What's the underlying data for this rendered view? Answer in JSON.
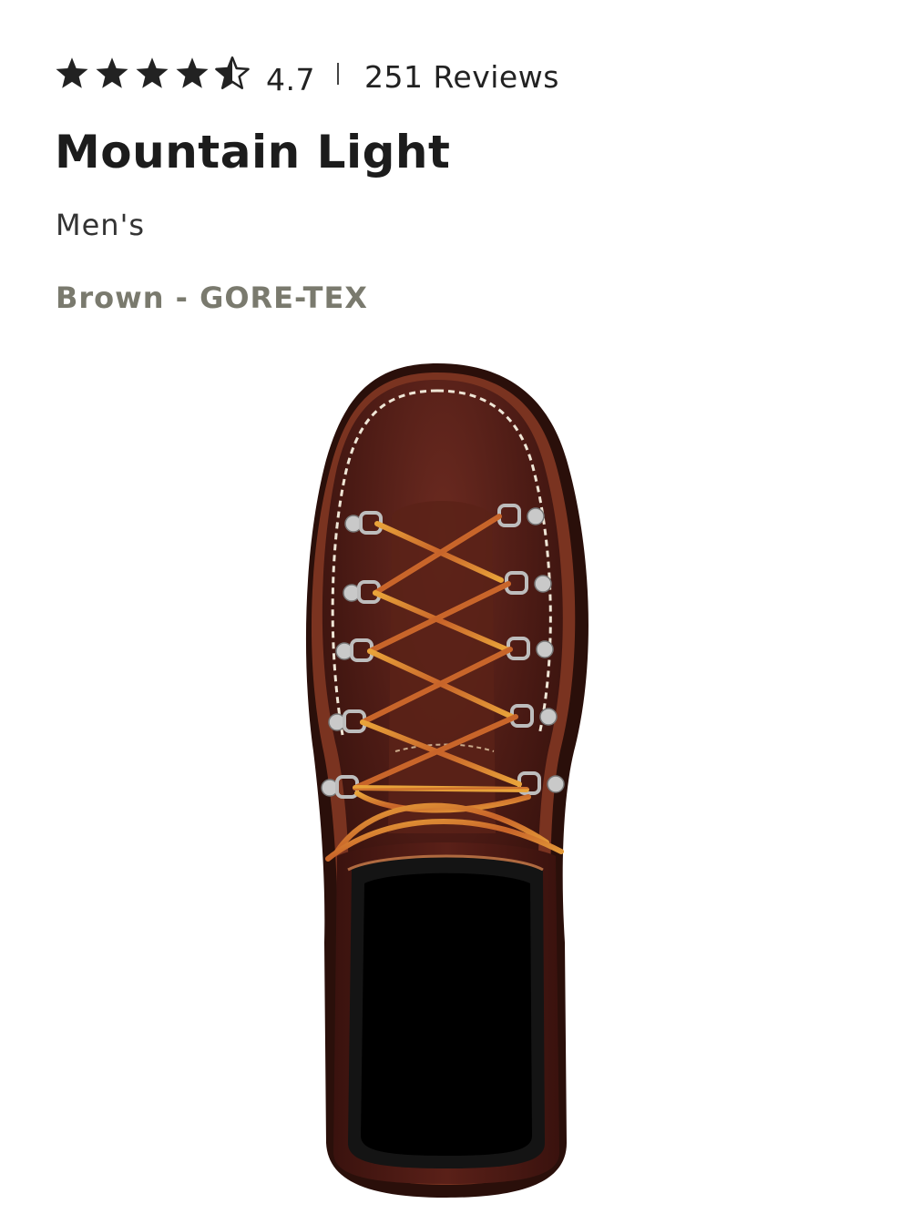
{
  "rating": {
    "stars_filled": 4.5,
    "stars_total": 5,
    "value": "4.7",
    "separator": "|",
    "review_count": "251 Reviews"
  },
  "product": {
    "title": "Mountain Light",
    "gender": "Men's",
    "color": "Brown - GORE-TEX",
    "image_alt": "Mountain Light boot top view"
  },
  "colors": {
    "text": "#1c1c1c",
    "muted": "#7a7a6e",
    "star": "#222222",
    "leather": "#4a1a14",
    "lace": "#d98a2a"
  },
  "icons": [
    "star-icon",
    "half-star-icon"
  ]
}
